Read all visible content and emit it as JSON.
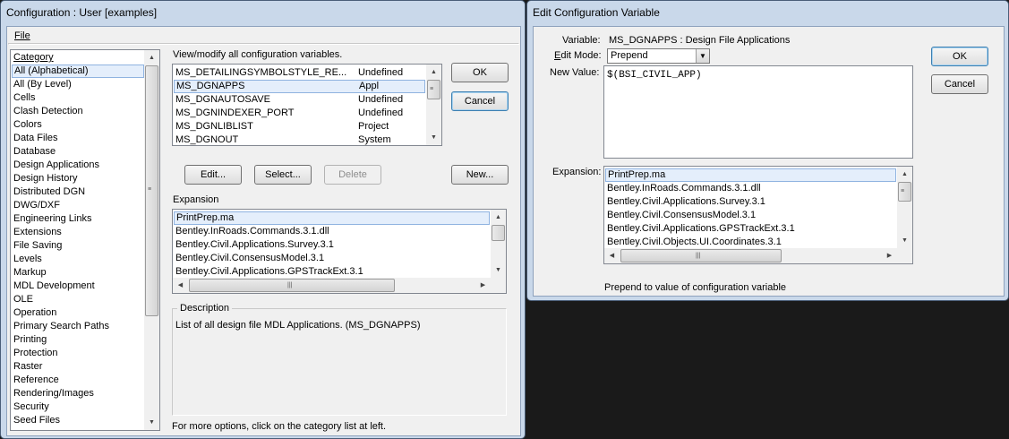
{
  "config_window": {
    "title": "Configuration : User [examples]",
    "menu": {
      "file": "File"
    },
    "category_header": "Category",
    "categories": [
      "All (Alphabetical)",
      "All (By Level)",
      "Cells",
      "Clash Detection",
      "Colors",
      "Data Files",
      "Database",
      "Design Applications",
      "Design History",
      "Distributed DGN",
      "DWG/DXF",
      "Engineering Links",
      "Extensions",
      "File Saving",
      "Levels",
      "Markup",
      "MDL Development",
      "OLE",
      "Operation",
      "Primary Search Paths",
      "Printing",
      "Protection",
      "Raster",
      "Reference",
      "Rendering/Images",
      "Security",
      "Seed Files"
    ],
    "view_label": "View/modify all configuration variables.",
    "variables": [
      {
        "name": "MS_DETAILINGSYMBOLSTYLE_RE...",
        "level": "Undefined"
      },
      {
        "name": "MS_DGNAPPS",
        "level": "Appl"
      },
      {
        "name": "MS_DGNAUTOSAVE",
        "level": "Undefined"
      },
      {
        "name": "MS_DGNINDEXER_PORT",
        "level": "Undefined"
      },
      {
        "name": "MS_DGNLIBLIST",
        "level": "Project"
      },
      {
        "name": "MS_DGNOUT",
        "level": "System"
      }
    ],
    "buttons": {
      "ok": "OK",
      "cancel": "Cancel",
      "edit": "Edit...",
      "select": "Select...",
      "delete": "Delete",
      "new": "New..."
    },
    "expansion_label": "Expansion",
    "expansion": [
      "PrintPrep.ma",
      "Bentley.InRoads.Commands.3.1.dll",
      "Bentley.Civil.Applications.Survey.3.1",
      "Bentley.Civil.ConsensusModel.3.1",
      "Bentley.Civil.Applications.GPSTrackExt.3.1"
    ],
    "description_label": "Description",
    "description": "List of all design file MDL Applications. (MS_DGNAPPS)",
    "footer": "For more options, click on the category list at left."
  },
  "edit_window": {
    "title": "Edit Configuration Variable",
    "variable_label": "Variable:",
    "variable_value": "MS_DGNAPPS : Design File Applications",
    "edit_mode_label": "Edit Mode:",
    "edit_mode_value": "Prepend",
    "new_value_label": "New Value:",
    "new_value": "$(BSI_CIVIL_APP)",
    "expansion_label": "Expansion:",
    "expansion": [
      "PrintPrep.ma",
      "Bentley.InRoads.Commands.3.1.dll",
      "Bentley.Civil.Applications.Survey.3.1",
      "Bentley.Civil.ConsensusModel.3.1",
      "Bentley.Civil.Applications.GPSTrackExt.3.1",
      "Bentley.Civil.Objects.UI.Coordinates.3.1"
    ],
    "status": "Prepend to value of configuration variable",
    "buttons": {
      "ok": "OK",
      "cancel": "Cancel"
    }
  },
  "icons": {
    "scroll_up": "scroll-up-arrow-icon",
    "scroll_down": "scroll-down-arrow-icon",
    "scroll_left": "scroll-left-arrow-icon",
    "scroll_right": "scroll-right-arrow-icon",
    "dropdown": "chevron-down-icon"
  }
}
